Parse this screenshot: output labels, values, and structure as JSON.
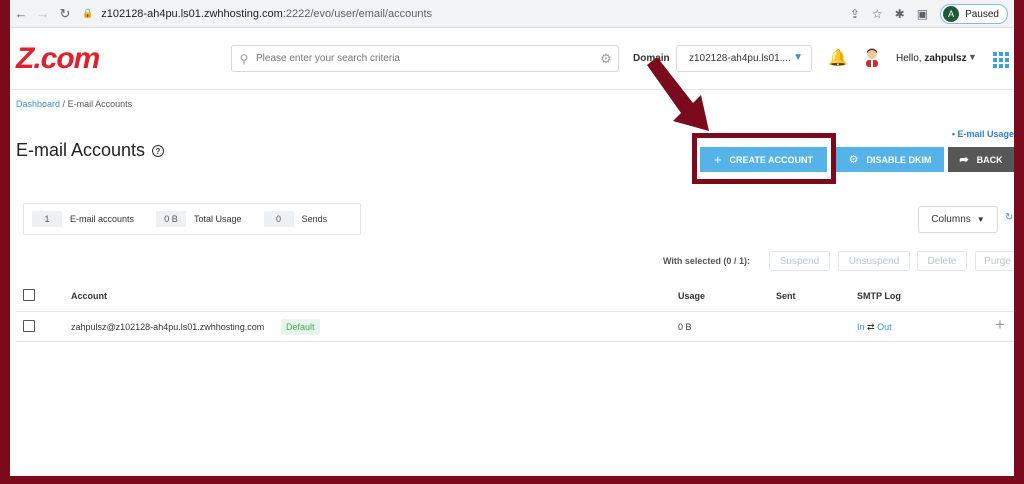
{
  "browser": {
    "url_host": "z102128-ah4pu.ls01.zwhhosting.com",
    "url_path": ":2222/evo/user/email/accounts",
    "profile_initial": "A",
    "profile_status": "Paused"
  },
  "header": {
    "logo": "Z.com",
    "search_placeholder": "Please enter your search criteria",
    "domain_label": "Domain",
    "domain_value": "z102128-ah4pu.ls01....",
    "greeting": "Hello,",
    "username": "zahpulsz"
  },
  "breadcrumb": {
    "dashboard": "Dashboard",
    "separator": "/",
    "current": "E-mail Accounts"
  },
  "page": {
    "title": "E-mail Accounts",
    "email_usage_link": "• E-mail Usage"
  },
  "buttons": {
    "create_account": "CREATE ACCOUNT",
    "disable_dkim": "DISABLE DKIM",
    "back": "BACK"
  },
  "stats": {
    "accounts_value": "1",
    "accounts_label": "E-mail accounts",
    "usage_value": "0 B",
    "usage_label": "Total Usage",
    "sends_value": "0",
    "sends_label": "Sends"
  },
  "toolbar": {
    "columns": "Columns",
    "with_selected": "With selected (0 / 1):",
    "suspend": "Suspend",
    "unsuspend": "Unsuspend",
    "delete": "Delete",
    "purge": "Purge"
  },
  "table": {
    "columns": [
      "Account",
      "Usage",
      "Sent",
      "SMTP Log"
    ],
    "rows": [
      {
        "account": "zahpulsz@z102128-ah4pu.ls01.zwhhosting.com",
        "badge": "Default",
        "usage": "0 B",
        "sent": "",
        "smtp_in": "In",
        "smtp_sep": "⇄",
        "smtp_out": "Out"
      }
    ]
  },
  "colors": {
    "accent": "#56b3ea",
    "brand": "#e0202a",
    "highlight": "#7a0a1c"
  }
}
